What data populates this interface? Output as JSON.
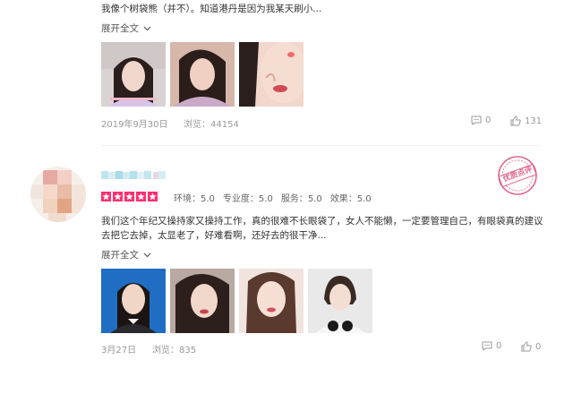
{
  "review1": {
    "text_tail": "我像个树袋熊（并不）。知道港丹是因为我某天刷小...",
    "expand": "展开全文",
    "date": "2019年9月30日",
    "views": "浏览：44154",
    "comments": "0",
    "likes": "131"
  },
  "review2": {
    "badge": "优质点评",
    "ratings": [
      {
        "label": "环境：",
        "value": "5.0"
      },
      {
        "label": "专业度：",
        "value": "5.0"
      },
      {
        "label": "服务：",
        "value": "5.0"
      },
      {
        "label": "效果：",
        "value": "5.0"
      }
    ],
    "stars": 5,
    "text_line1": "我们这个年纪又操持家又操持工作，真的很难不长眼袋了，女人不能懒，一定要管理自己，有眼袋真的建议",
    "text_line2": "去把它去掉，太显老了，好难看啊，还好去的很干净...",
    "expand": "展开全文",
    "date": "3月27日",
    "views": "浏览：835",
    "comments": "0",
    "likes": "0"
  },
  "colors": {
    "accent": "#ff2d6f",
    "muted": "#999999",
    "badge": "#e0668c"
  }
}
